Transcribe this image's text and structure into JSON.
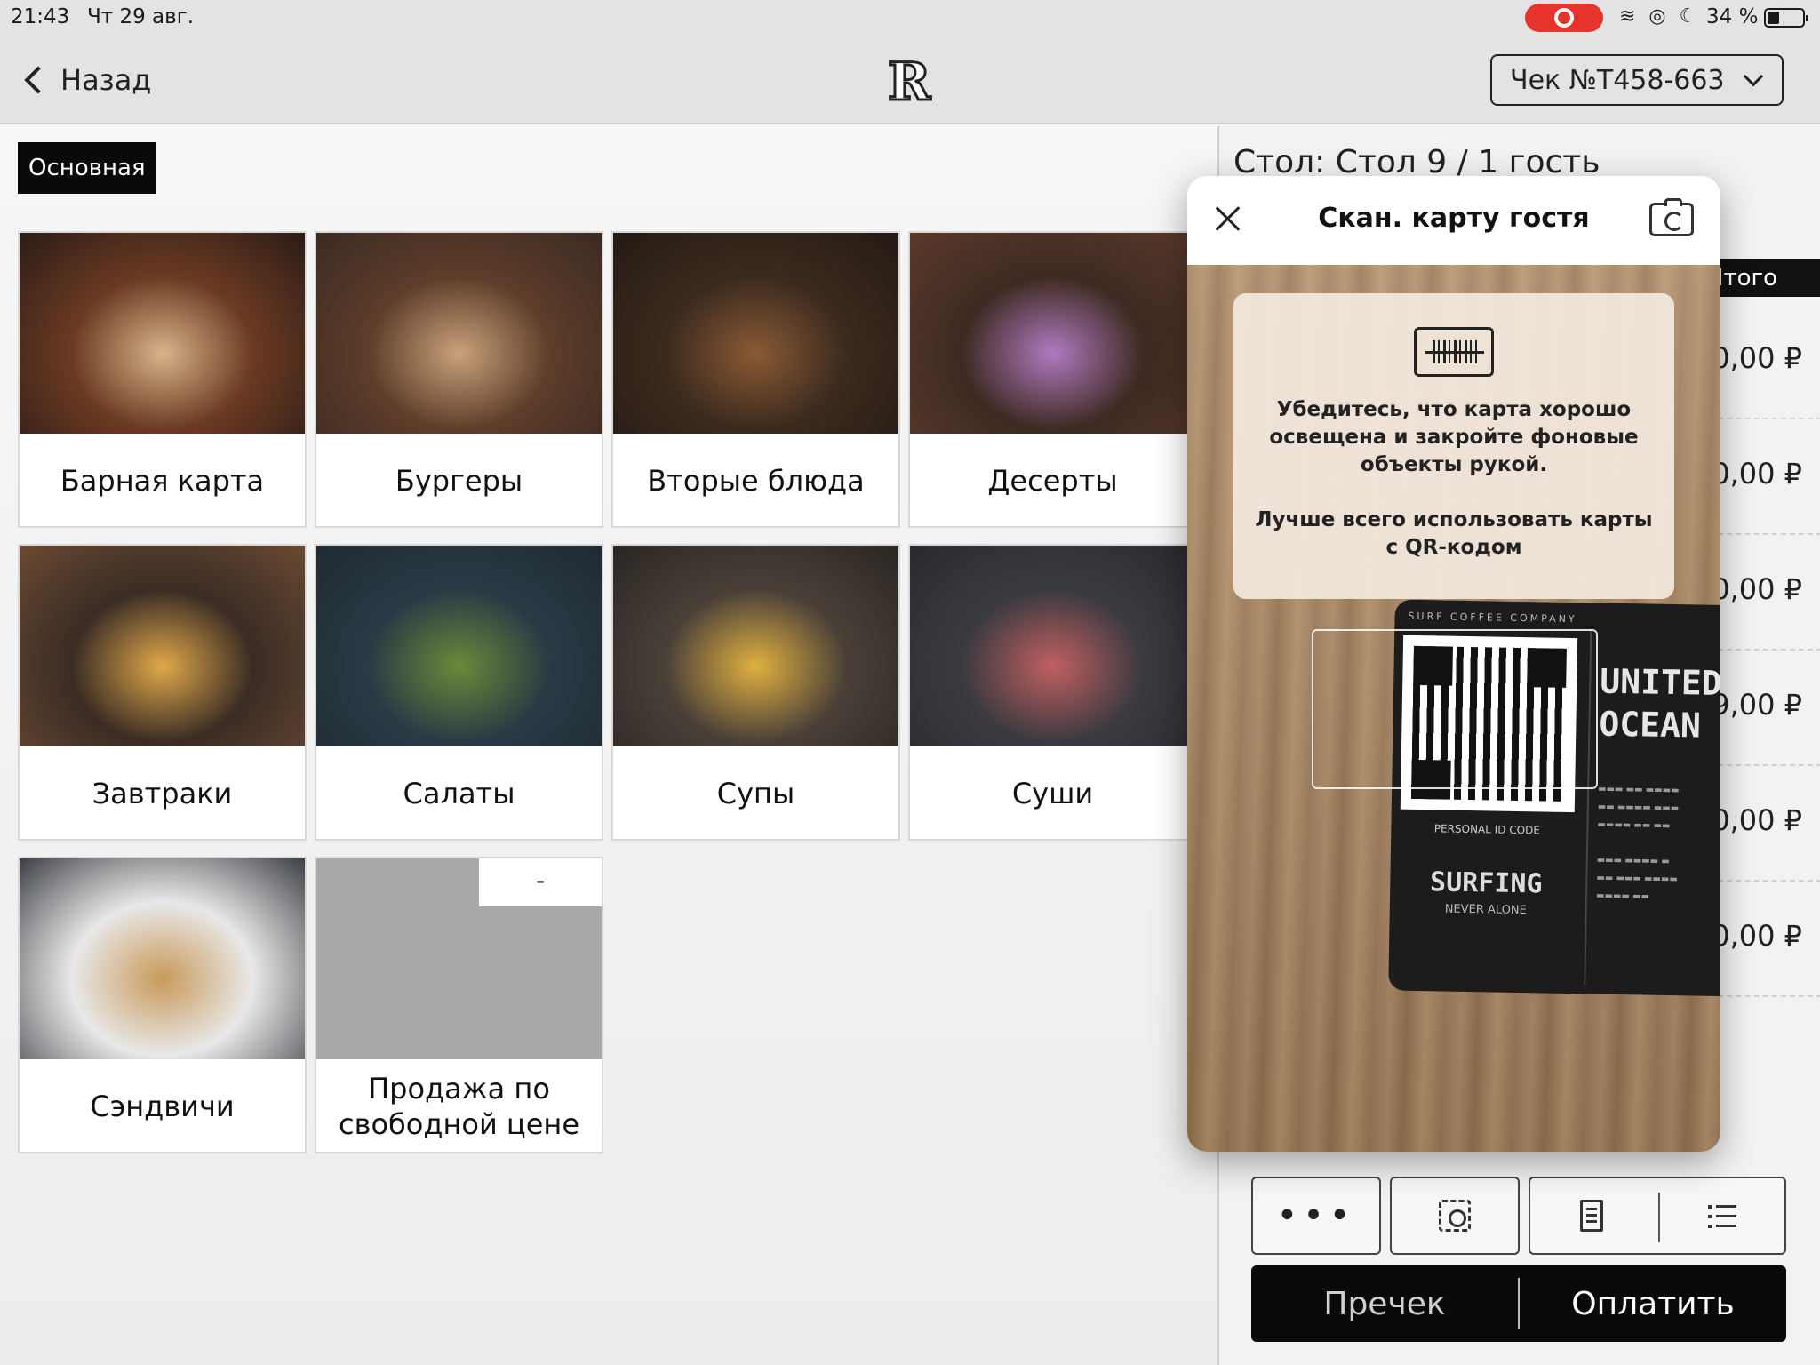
{
  "status_bar": {
    "time": "21:43",
    "date": "Чт 29 авг.",
    "battery": "34 %"
  },
  "nav": {
    "back_label": "Назад",
    "logo_letter": "R",
    "check_label": "Чек №T458-663"
  },
  "menu": {
    "tab_label": "Основная",
    "categories": [
      {
        "label": "Барная карта",
        "colors": [
          "#2a1c16",
          "#d8b48a",
          "#6b3a22"
        ]
      },
      {
        "label": "Бургеры",
        "colors": [
          "#3a2a22",
          "#c9a27a",
          "#5e3d2a"
        ]
      },
      {
        "label": "Вторые блюда",
        "colors": [
          "#241a14",
          "#8a5a34",
          "#3b2a1e"
        ]
      },
      {
        "label": "Десерты",
        "colors": [
          "#5a3a2a",
          "#b07ac0",
          "#3e2a22"
        ]
      },
      {
        "label": "Завтраки",
        "colors": [
          "#6a4a32",
          "#e0a94a",
          "#3a2c24"
        ]
      },
      {
        "label": "Салаты",
        "colors": [
          "#1f2a34",
          "#6a8a3a",
          "#2a3a44"
        ]
      },
      {
        "label": "Супы",
        "colors": [
          "#2a2622",
          "#e0b040",
          "#4a4038"
        ]
      },
      {
        "label": "Суши",
        "colors": [
          "#2a2a2e",
          "#c06060",
          "#3a3a40"
        ]
      },
      {
        "label": "Сэндвичи",
        "colors": [
          "#3c3f44",
          "#c89a5a",
          "#e8e8e8"
        ]
      }
    ],
    "free_price": {
      "label": "Продажа по свободной цене",
      "badge": "-"
    }
  },
  "check": {
    "table_info": "Стол: Стол 9 / 1 гость",
    "total_header": "Итого",
    "prices": [
      "0,00 ₽",
      "0,00 ₽",
      "0,00 ₽",
      "9,00 ₽",
      "0,00 ₽",
      "0,00 ₽"
    ],
    "precheck_label": "Пречек",
    "pay_label": "Оплатить"
  },
  "scan_modal": {
    "title": "Скан. карту гостя",
    "hint_1": "Убедитесь, что карта хорошо освещена и закройте фоновые объекты рукой.",
    "hint_2": "Лучше всего использовать карты с QR-кодом",
    "card": {
      "brand": "SURF COFFEE COMPANY",
      "personal": "PERSONAL ID CODE",
      "surfing": "SURFING",
      "never_alone": "NEVER ALONE",
      "united": "UNITED",
      "ocean": "OCEAN"
    }
  }
}
